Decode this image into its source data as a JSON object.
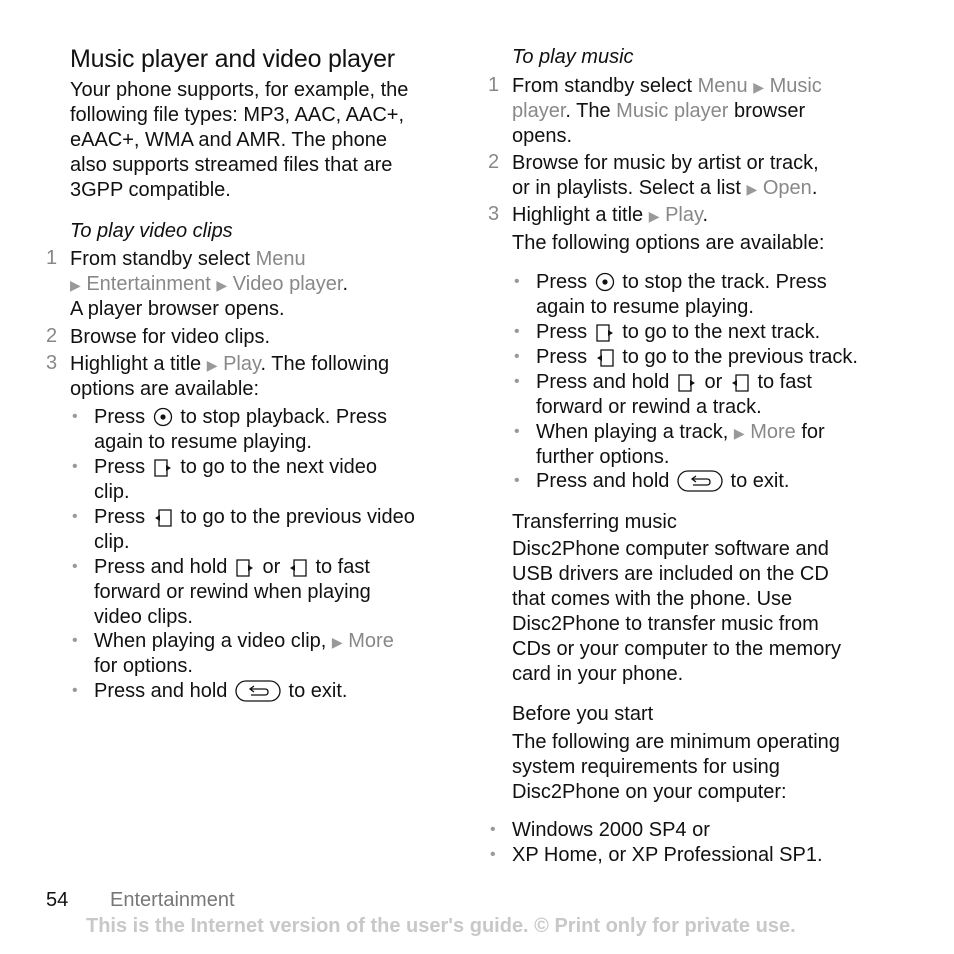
{
  "page": {
    "number": "54",
    "section": "Entertainment",
    "notice": "This is the Internet version of the user's guide. © Print only for private use."
  },
  "left": {
    "title": "Music player and video player",
    "intro": [
      "Your phone supports, for example, the",
      "following file types: MP3, AAC, AAC+,",
      "eAAC+, WMA and AMR. The phone",
      "also supports streamed files that are",
      "3GPP compatible."
    ],
    "video_heading": "To play video clips",
    "steps": [
      {
        "n": "1",
        "a": "From standby select ",
        "menu": "Menu",
        "b": "Entertainment",
        "c": "Video player",
        "d": "A player browser opens."
      },
      {
        "n": "2",
        "text": "Browse for video clips."
      },
      {
        "n": "3",
        "a": "Highlight a title ",
        "play": "Play",
        "rest": ". The following",
        "line2": "options are available:"
      }
    ],
    "bullets": [
      {
        "pre": "Press ",
        "post": " to stop playback. Press",
        "line2": "again to resume playing."
      },
      {
        "pre": "Press ",
        "post": " to go to the next video",
        "line2": "clip."
      },
      {
        "pre": "Press ",
        "post": " to go to the previous video",
        "line2": "clip."
      },
      {
        "pre": "Press and hold ",
        "mid": " or ",
        "post": " to fast",
        "line2": "forward or rewind when playing",
        "line3": "video clips."
      },
      {
        "pre": "When playing a video clip, ",
        "more": "More",
        "line2": "for options."
      },
      {
        "pre": "Press and hold ",
        "post": " to exit."
      }
    ]
  },
  "right": {
    "music_heading": "To play music",
    "steps": [
      {
        "n": "1",
        "a": "From standby select ",
        "menu": "Menu",
        "music": "Music",
        "l2a": "player",
        "l2b": ". The ",
        "l2c": "Music player",
        "l2d": " browser",
        "l3": "opens."
      },
      {
        "n": "2",
        "a": "Browse for music by artist or track,",
        "b": "or in playlists. Select a list ",
        "open": "Open"
      },
      {
        "n": "3",
        "a": "Highlight a title ",
        "play": "Play",
        "options": "The following options are available:"
      }
    ],
    "bullets": [
      {
        "pre": "Press ",
        "post": " to stop the track. Press",
        "line2": "again to resume playing."
      },
      {
        "pre": "Press ",
        "post": " to go to the next track."
      },
      {
        "pre": "Press ",
        "post": " to go to the previous track."
      },
      {
        "pre": "Press and hold ",
        "mid": " or ",
        "post": " to fast",
        "line2": "forward or rewind a track."
      },
      {
        "pre": "When playing a track, ",
        "more": "More",
        "post": " for",
        "line2": "further options."
      },
      {
        "pre": "Press and hold ",
        "post": " to exit."
      }
    ],
    "transfer_heading": "Transferring music",
    "transfer": [
      "Disc2Phone computer software and",
      "USB drivers are included on the CD",
      "that comes with the phone. Use",
      "Disc2Phone to transfer music from",
      "CDs or your computer to the memory",
      "card in your phone."
    ],
    "before_heading": "Before you start",
    "before": [
      "The following are minimum operating",
      "system requirements for using",
      "Disc2Phone on your computer:"
    ],
    "req": [
      "Windows 2000 SP4 or",
      "XP Home, or XP Professional SP1."
    ]
  },
  "icons": {
    "arrow": "▶",
    "bullet": "•"
  }
}
